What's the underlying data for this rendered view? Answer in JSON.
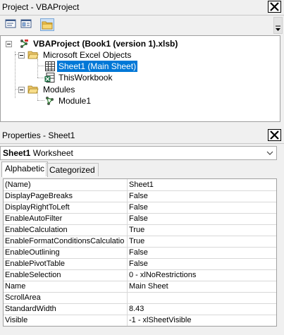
{
  "project_panel": {
    "title": "Project - VBAProject",
    "toolbar": {
      "buttons": [
        {
          "icon": "view-code-icon"
        },
        {
          "icon": "view-object-icon"
        },
        {
          "icon": "toggle-folders-icon",
          "active": true
        }
      ]
    },
    "tree": {
      "root": "VBAProject (Book1 (version 1).xlsb)",
      "excel_objects_folder": "Microsoft Excel Objects",
      "sheet1": "Sheet1 (Main Sheet)",
      "thisworkbook": "ThisWorkbook",
      "modules_folder": "Modules",
      "module1": "Module1"
    }
  },
  "properties_panel": {
    "title": "Properties - Sheet1",
    "object": {
      "name": "Sheet1",
      "type": "Worksheet"
    },
    "tabs": [
      "Alphabetic",
      "Categorized"
    ],
    "active_tab": "Alphabetic",
    "rows": [
      {
        "name": "(Name)",
        "value": "Sheet1"
      },
      {
        "name": "DisplayPageBreaks",
        "value": "False"
      },
      {
        "name": "DisplayRightToLeft",
        "value": "False"
      },
      {
        "name": "EnableAutoFilter",
        "value": "False"
      },
      {
        "name": "EnableCalculation",
        "value": "True"
      },
      {
        "name": "EnableFormatConditionsCalculation",
        "value": "True"
      },
      {
        "name": "EnableOutlining",
        "value": "False"
      },
      {
        "name": "EnablePivotTable",
        "value": "False"
      },
      {
        "name": "EnableSelection",
        "value": "0 - xlNoRestrictions"
      },
      {
        "name": "Name",
        "value": "Main Sheet"
      },
      {
        "name": "ScrollArea",
        "value": ""
      },
      {
        "name": "StandardWidth",
        "value": "8.43"
      },
      {
        "name": "Visible",
        "value": "-1 - xlSheetVisible"
      }
    ]
  },
  "colors": {
    "selection": "#0078d7",
    "panel_bg": "#f0f0f0",
    "grid_line": "#d8d8d8"
  }
}
